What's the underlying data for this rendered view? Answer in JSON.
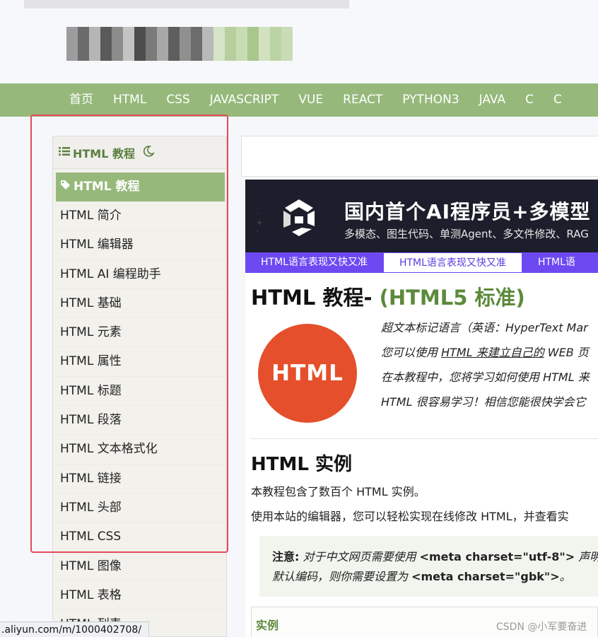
{
  "nav": {
    "items": [
      "首页",
      "HTML",
      "CSS",
      "JAVASCRIPT",
      "VUE",
      "REACT",
      "PYTHON3",
      "JAVA",
      "C",
      "C"
    ]
  },
  "sidebar": {
    "title": "HTML 教程",
    "active_label": "HTML 教程",
    "items": [
      "HTML 简介",
      "HTML 编辑器",
      "HTML AI 编程助手",
      "HTML 基础",
      "HTML 元素",
      "HTML 属性",
      "HTML 标题",
      "HTML 段落",
      "HTML 文本格式化",
      "HTML 链接",
      "HTML 头部",
      "HTML CSS",
      "HTML 图像",
      "HTML 表格",
      "HTML 列表"
    ]
  },
  "banner": {
    "title": "国内首个AI程序员+多模型",
    "subtitle": "多模态、图生代码、单测Agent、多文件修改、RAG",
    "tabs": [
      "HTML语言表现又快又准",
      "HTML语言表现又快又准",
      "HTML语"
    ]
  },
  "content": {
    "title_main": "HTML 教程- ",
    "title_accent": "(HTML5 标准)",
    "logo_text": "HTML",
    "intro_1": "超文本标记语言（英语：HyperText Mar",
    "intro_2a": "您可以使用 ",
    "intro_2b": "HTML 来建立自己的",
    "intro_2c": " WEB 页",
    "intro_3": "在本教程中，您将学习如何使用 HTML 来",
    "intro_4": "HTML 很容易学习！相信您能很快学会它",
    "section_title": "HTML 实例",
    "para_1": "本教程包含了数百个 HTML 实例。",
    "para_2": "使用本站的编辑器，您可以轻松实现在线修改 HTML，并查看实",
    "note_label": "注意:",
    "note_text_1": " 对于中文网页需要使用 ",
    "note_code_1": "<meta charset=\"utf-8\">",
    "note_text_2": " 声明",
    "note_text_3": "默认编码，则你需要设置为 ",
    "note_code_2": "<meta charset=\"gbk\">",
    "note_text_4": "。",
    "example_label": "实例"
  },
  "status": {
    "url": ".aliyun.com/m/1000402708/"
  },
  "watermark": "CSDN @小军要奋进",
  "colors": {
    "nav_bg": "#96b97b",
    "accent_green": "#5c8a3c",
    "html_logo": "#e54f2b",
    "banner_tab": "#6d49f2",
    "highlight": "#e64a5c"
  }
}
